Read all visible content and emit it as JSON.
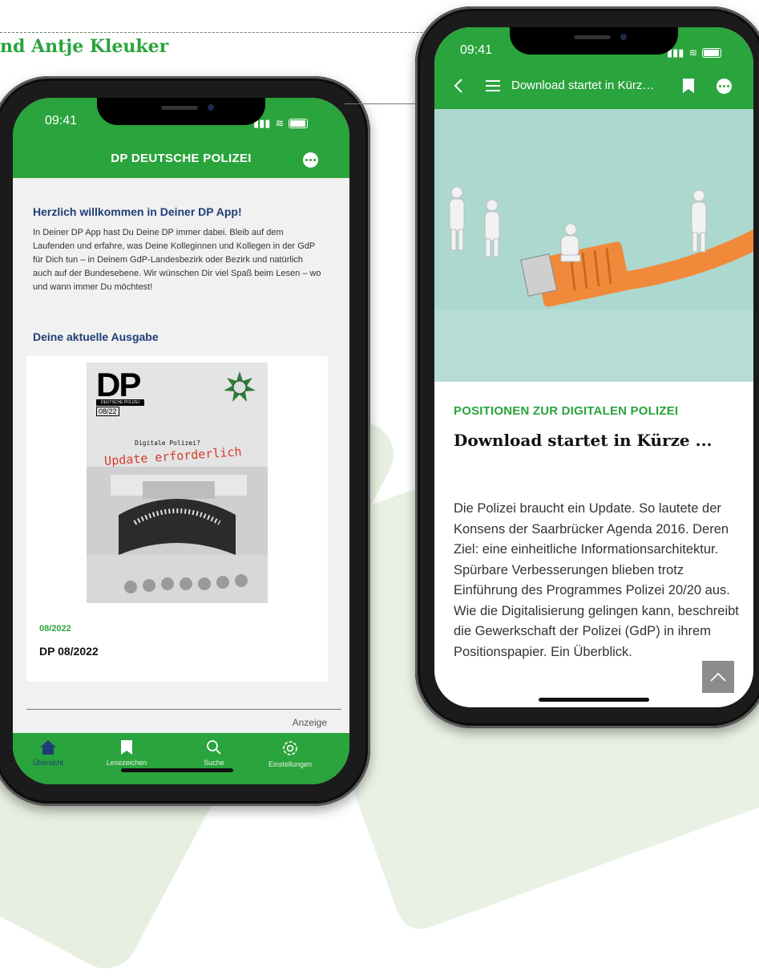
{
  "page": {
    "author_fragment": "nd Antje Kleuker"
  },
  "left_phone": {
    "status_time": "09:41",
    "header_title": "DP DEUTSCHE POLIZEI",
    "welcome_title": "Herzlich willkommen in Deiner DP App!",
    "welcome_text": "In Deiner DP App hast Du Deine DP immer dabei. Bleib auf dem Laufenden und erfahre, was Deine Kolleginnen und Kollegen in der GdP für Dich tun – in Deinem GdP-Landesbezirk oder Bezirk und natürlich auch auf der Bundesebene. Wir wünschen Dir viel Spaß beim Lesen – wo und wann immer Du möchtest!",
    "current_issue_label": "Deine aktuelle Ausgabe",
    "cover": {
      "masthead": "DP",
      "masthead_band": "DEUTSCHE POLIZEI",
      "issue_number": "08/22",
      "subline": "Digitale Polizei?",
      "headline": "Update erforderlich"
    },
    "issue_date": "08/2022",
    "issue_name": "DP 08/2022",
    "ad_label": "Anzeige",
    "tabs": [
      {
        "label": "Übersicht",
        "icon": "home-icon",
        "active": true
      },
      {
        "label": "Lesezeichen",
        "icon": "bookmark-icon",
        "active": false
      },
      {
        "label": "Suche",
        "icon": "search-icon",
        "active": false
      },
      {
        "label": "Einstellungen",
        "icon": "gear-icon",
        "active": false
      }
    ]
  },
  "right_phone": {
    "status_time": "09:41",
    "header_title": "Download startet in Kürz…",
    "kicker": "POSITIONEN ZUR DIGITALEN POLIZEI",
    "article_title": "Download startet in Kürze ...",
    "article_body": "Die Polizei braucht ein Update. So lautete der Konsens der Saarbrücker Agenda 2016. Deren Ziel: eine einheitliche Informationsarchitektur. Spürbare Verbesserungen blieben trotz Einführung des Programmes Polizei 20/20 aus. Wie die Digitalisierung gelingen kann, beschreibt die Gewerkschaft der Polizei (GdP) in ihrem Positionspapier. Ein Überblick."
  },
  "colors": {
    "brand_green": "#2aa43c",
    "heading_blue": "#1f3d77",
    "cover_red": "#d33a2a",
    "hero_teal": "#acd8d0",
    "cable_orange": "#f08a3a"
  }
}
